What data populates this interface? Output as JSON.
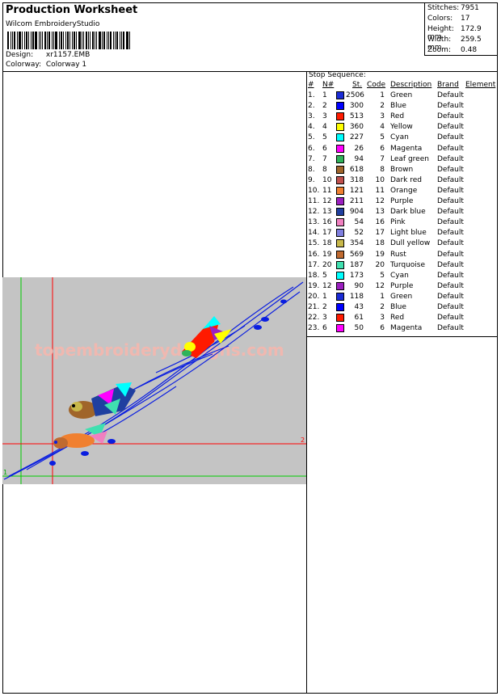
{
  "header": {
    "title": "Production Worksheet",
    "software": "Wilcom EmbroideryStudio",
    "design_label": "Design:",
    "design_value": "xr1157.EMB",
    "colorway_label": "Colorway:",
    "colorway_value": "Colorway 1"
  },
  "stats": [
    {
      "label": "Stitches:",
      "value": "7951"
    },
    {
      "label": "Colors:",
      "value": "17"
    },
    {
      "label": "Height:",
      "value": "172.9 mm"
    },
    {
      "label": "Width:",
      "value": "259.5 mm"
    },
    {
      "label": "Zoom:",
      "value": "0.48"
    }
  ],
  "stop_sequence": {
    "title": "Stop Sequence:",
    "columns": {
      "num": "#",
      "n": "N#",
      "st": "St.",
      "code": "Code",
      "description": "Description",
      "brand": "Brand",
      "element": "Element"
    },
    "rows": [
      {
        "num": "1.",
        "n": "1",
        "st": "2506",
        "code": "1",
        "description": "Green",
        "brand": "Default",
        "color": "#1a2bd6"
      },
      {
        "num": "2.",
        "n": "2",
        "st": "300",
        "code": "2",
        "description": "Blue",
        "brand": "Default",
        "color": "#0000ff"
      },
      {
        "num": "3.",
        "n": "3",
        "st": "513",
        "code": "3",
        "description": "Red",
        "brand": "Default",
        "color": "#ff1a00"
      },
      {
        "num": "4.",
        "n": "4",
        "st": "360",
        "code": "4",
        "description": "Yellow",
        "brand": "Default",
        "color": "#ffff00"
      },
      {
        "num": "5.",
        "n": "5",
        "st": "227",
        "code": "5",
        "description": "Cyan",
        "brand": "Default",
        "color": "#00ffff"
      },
      {
        "num": "6.",
        "n": "6",
        "st": "26",
        "code": "6",
        "description": "Magenta",
        "brand": "Default",
        "color": "#ff00ff"
      },
      {
        "num": "7.",
        "n": "7",
        "st": "94",
        "code": "7",
        "description": "Leaf green",
        "brand": "Default",
        "color": "#2fb35a"
      },
      {
        "num": "8.",
        "n": "8",
        "st": "618",
        "code": "8",
        "description": "Brown",
        "brand": "Default",
        "color": "#a0652a"
      },
      {
        "num": "9.",
        "n": "10",
        "st": "318",
        "code": "10",
        "description": "Dark red",
        "brand": "Default",
        "color": "#c0504d"
      },
      {
        "num": "10.",
        "n": "11",
        "st": "121",
        "code": "11",
        "description": "Orange",
        "brand": "Default",
        "color": "#f08030"
      },
      {
        "num": "11.",
        "n": "12",
        "st": "211",
        "code": "12",
        "description": "Purple",
        "brand": "Default",
        "color": "#9b1fc0"
      },
      {
        "num": "12.",
        "n": "13",
        "st": "904",
        "code": "13",
        "description": "Dark blue",
        "brand": "Default",
        "color": "#1f3fa0"
      },
      {
        "num": "13.",
        "n": "16",
        "st": "54",
        "code": "16",
        "description": "Pink",
        "brand": "Default",
        "color": "#f080c0"
      },
      {
        "num": "14.",
        "n": "17",
        "st": "52",
        "code": "17",
        "description": "Light blue",
        "brand": "Default",
        "color": "#7f7fe0"
      },
      {
        "num": "15.",
        "n": "18",
        "st": "354",
        "code": "18",
        "description": "Dull yellow",
        "brand": "Default",
        "color": "#c8b84a"
      },
      {
        "num": "16.",
        "n": "19",
        "st": "569",
        "code": "19",
        "description": "Rust",
        "brand": "Default",
        "color": "#c06a30"
      },
      {
        "num": "17.",
        "n": "20",
        "st": "187",
        "code": "20",
        "description": "Turquoise",
        "brand": "Default",
        "color": "#40e0b0"
      },
      {
        "num": "18.",
        "n": "5",
        "st": "173",
        "code": "5",
        "description": "Cyan",
        "brand": "Default",
        "color": "#00ffff"
      },
      {
        "num": "19.",
        "n": "12",
        "st": "90",
        "code": "12",
        "description": "Purple",
        "brand": "Default",
        "color": "#9b1fc0"
      },
      {
        "num": "20.",
        "n": "1",
        "st": "118",
        "code": "1",
        "description": "Green",
        "brand": "Default",
        "color": "#1a2bd6"
      },
      {
        "num": "21.",
        "n": "2",
        "st": "43",
        "code": "2",
        "description": "Blue",
        "brand": "Default",
        "color": "#0000ff"
      },
      {
        "num": "22.",
        "n": "3",
        "st": "61",
        "code": "3",
        "description": "Red",
        "brand": "Default",
        "color": "#ff1a00"
      },
      {
        "num": "23.",
        "n": "6",
        "st": "50",
        "code": "6",
        "description": "Magenta",
        "brand": "Default",
        "color": "#ff00ff"
      }
    ]
  },
  "preview": {
    "watermark": "topembroiderydesigns.com",
    "marker_1": "1",
    "marker_2": "2"
  }
}
